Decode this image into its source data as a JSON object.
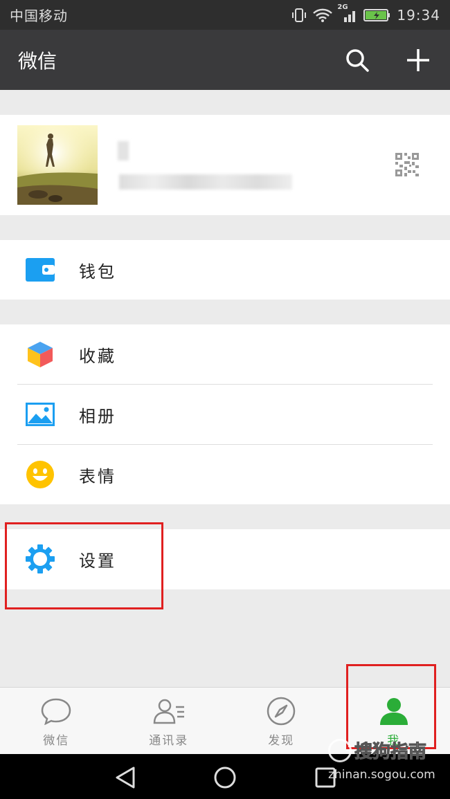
{
  "status_bar": {
    "carrier": "中国移动",
    "network": "2G",
    "time": "19:34"
  },
  "app_bar": {
    "title": "微信",
    "icons": [
      "search-icon",
      "plus-icon"
    ]
  },
  "profile": {
    "name": "",
    "wechat_id": "",
    "qr_icon": "qr-code-icon"
  },
  "menu": {
    "wallet": {
      "label": "钱包",
      "icon": "wallet-icon",
      "color": "#1b9ff1"
    },
    "favorites": {
      "label": "收藏",
      "icon": "cube-icon"
    },
    "album": {
      "label": "相册",
      "icon": "photo-icon",
      "color": "#1b9ff1"
    },
    "stickers": {
      "label": "表情",
      "icon": "smiley-icon",
      "color": "#ffc300"
    },
    "settings": {
      "label": "设置",
      "icon": "gear-icon",
      "color": "#1b9ff1"
    }
  },
  "tabs": [
    {
      "label": "微信",
      "icon": "chat-bubble-icon",
      "active": false
    },
    {
      "label": "通讯录",
      "icon": "contacts-icon",
      "active": false
    },
    {
      "label": "发现",
      "icon": "compass-icon",
      "active": false
    },
    {
      "label": "我",
      "icon": "person-icon",
      "active": true
    }
  ],
  "colors": {
    "accent_green": "#2bad38",
    "highlight_red": "#e02020",
    "header_bg": "#3a3a3c"
  },
  "watermark": {
    "brand": "搜狗指南",
    "domain": "zhinan.sogou.com"
  }
}
